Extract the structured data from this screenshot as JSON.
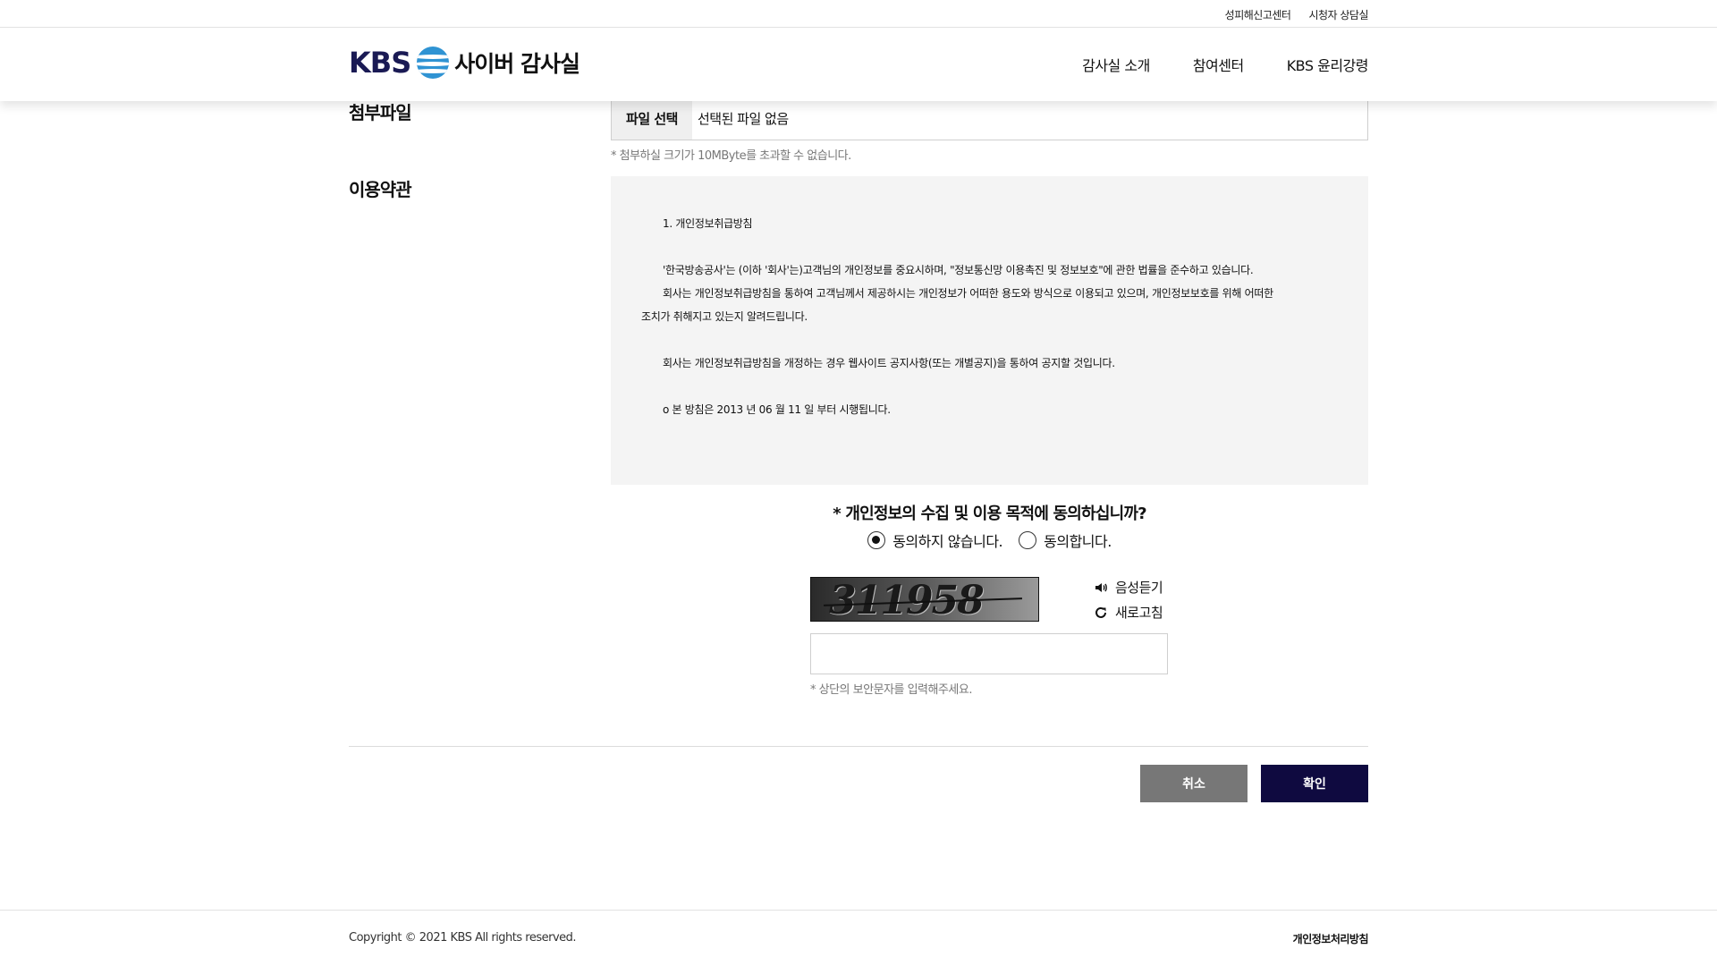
{
  "util_links": [
    "성피해신고센터",
    "시청자 상담실"
  ],
  "header": {
    "logo_kbs": "KBS",
    "logo_title": "사이버 감사실",
    "nav": [
      "감사실 소개",
      "참여센터",
      "KBS 윤리강령"
    ]
  },
  "attachment": {
    "label": "첨부파일",
    "button": "파일 선택",
    "file_name": "선택된 파일 없음",
    "note": "* 첨부하실 크기가 10MByte를 초과할 수 없습니다."
  },
  "terms": {
    "label": "이용약관",
    "lines": [
      "1. 개인정보취급방침",
      "'한국방송공사'는 (이하 '회사'는)고객님의 개인정보를 중요시하며, \"정보통신망 이용촉진 및 정보보호\"에 관한 법률을 준수하고 있습니다.",
      "회사는 개인정보취급방침을 통하여 고객님께서 제공하시는 개인정보가 어떠한 용도와 방식으로 이용되고 있으며, 개인정보보호를 위해 어떠한",
      "조치가 취해지고 있는지 알려드립니다.",
      "회사는 개인정보취급방침을 개정하는 경우 웹사이트 공지사항(또는 개별공지)을 통하여 공지할 것입니다.",
      "o 본 방침은 2013 년 06 월 11 일 부터 시행됩니다."
    ]
  },
  "consent": {
    "question": "* 개인정보의 수집 및 이용 목적에 동의하십니까?",
    "options": [
      "동의하지 않습니다.",
      "동의합니다."
    ],
    "selected": "동의하지 않습니다."
  },
  "captcha": {
    "image_text": "311958",
    "audio_label": "음성듣기",
    "refresh_label": "새로고침",
    "input_value": "",
    "note": "* 상단의 보안문자를 입력해주세요."
  },
  "actions": {
    "cancel": "취소",
    "ok": "확인"
  },
  "footer": {
    "copyright": "Copyright © 2021 KBS All rights reserved.",
    "privacy": "개인정보처리방침"
  }
}
